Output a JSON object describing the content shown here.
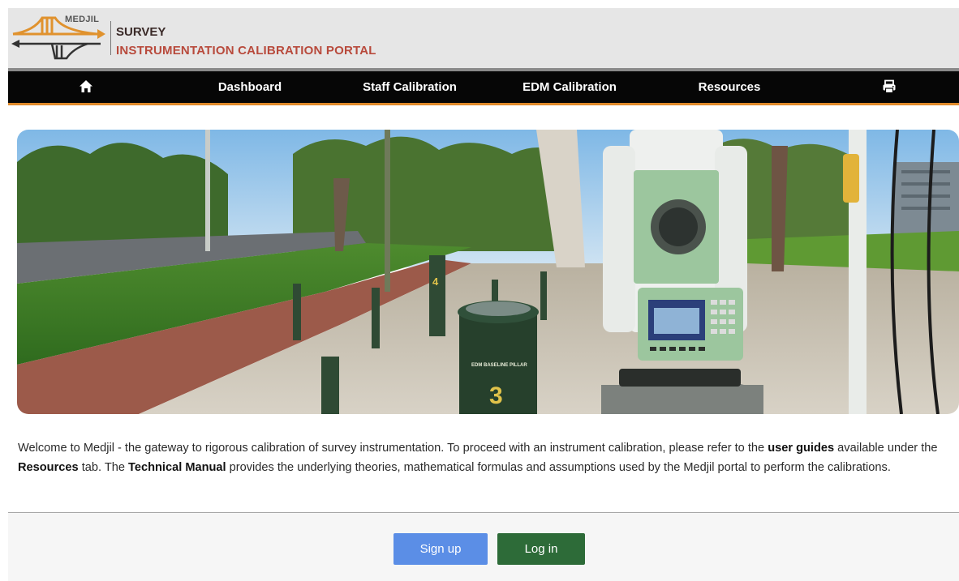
{
  "header": {
    "logo_text": "MEDJIL",
    "brand_line1": "SURVEY",
    "brand_line2": "INSTRUMENTATION CALIBRATION PORTAL"
  },
  "nav": {
    "items": [
      {
        "label": "Dashboard"
      },
      {
        "label": "Staff Calibration"
      },
      {
        "label": "EDM Calibration"
      },
      {
        "label": "Resources"
      }
    ],
    "home_icon": "home-icon",
    "print_icon": "printer-icon",
    "accent_color": "#e08a2a"
  },
  "hero": {
    "pillar_label": "EDM BASELINE PILLAR",
    "pillar_number": "3",
    "post_number": "4"
  },
  "intro": {
    "p1": "Welcome to Medjil - the gateway to rigorous calibration of survey instrumentation. To proceed with an instrument calibration, please refer to the ",
    "b1": "user guides",
    "p2": " available under the ",
    "b2": "Resources",
    "p3": " tab. The ",
    "b3": "Technical Manual",
    "p4": " provides the underlying theories, mathematical formulas and assumptions used by the Medjil portal to perform the calibrations."
  },
  "buttons": {
    "signup": "Sign up",
    "login": "Log in",
    "signup_color": "#5b8ee6",
    "login_color": "#2d6b38"
  }
}
